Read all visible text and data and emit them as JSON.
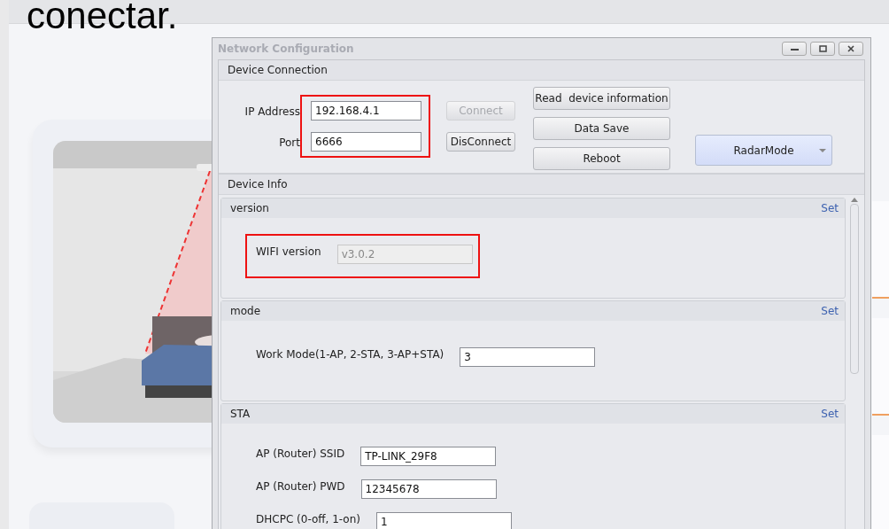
{
  "overlay_text": "conectar.",
  "dialog": {
    "title": "Network Configuration"
  },
  "connection": {
    "title": "Device Connection",
    "highlighted": true,
    "fields": [
      {
        "label": "IP Address",
        "value": "192.168.4.1"
      },
      {
        "label": "Port",
        "value": "6666"
      }
    ],
    "buttons": [
      {
        "label": "Connect",
        "disabled": true
      },
      {
        "label": "DisConnect",
        "disabled": false
      }
    ],
    "actions": [
      "Read  device information",
      "Data Save",
      "Reboot"
    ],
    "mode_select": "RadarMode"
  },
  "info": {
    "title": "Device Info",
    "sections": [
      {
        "title": "version",
        "action": "Set",
        "highlighted": true,
        "rows": [
          {
            "label": "WIFI version",
            "value": "v3.0.2",
            "disabled": true
          }
        ]
      },
      {
        "title": "mode",
        "action": "Set",
        "highlighted": false,
        "rows": [
          {
            "label": "Work Mode(1-AP, 2-STA, 3-AP+STA)",
            "value": "3",
            "disabled": false
          }
        ]
      },
      {
        "title": "STA",
        "action": "Set",
        "highlighted": false,
        "rows": [
          {
            "label": "AP (Router) SSID",
            "value": "TP-LINK_29F8",
            "disabled": false
          },
          {
            "label": "AP (Router) PWD",
            "value": "12345678",
            "disabled": false
          },
          {
            "label": "DHCPC (0-off, 1-on)",
            "value": "1",
            "disabled": false
          }
        ]
      }
    ]
  }
}
